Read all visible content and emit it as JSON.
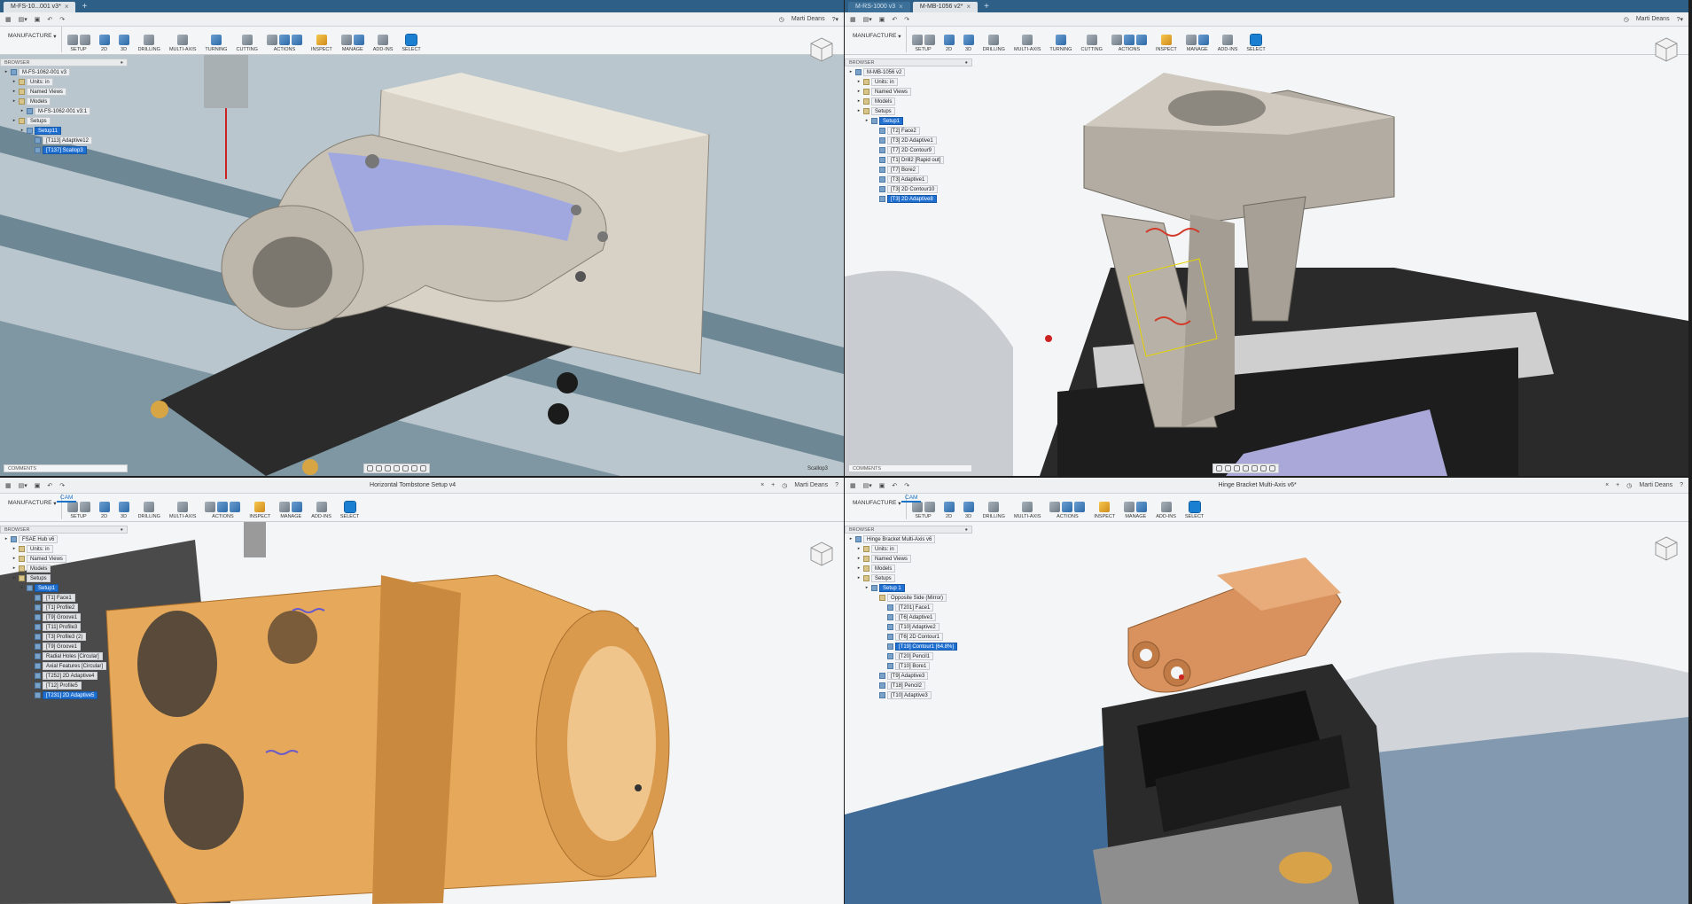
{
  "panes": [
    {
      "tabs": [
        {
          "label": "M-FS-10...001 v3*",
          "active": true
        }
      ],
      "user": "Marti Deans",
      "workspace": "MANUFACTURE",
      "groups": [
        "SETUP",
        "2D",
        "3D",
        "DRILLING",
        "MULTI-AXIS",
        "TURNING",
        "CUTTING",
        "ACTIONS",
        "INSPECT",
        "MANAGE",
        "ADD-INS",
        "SELECT"
      ],
      "browser_title": "BROWSER",
      "tree": [
        {
          "label": "M-FS-1062-001 v3",
          "depth": 0,
          "icon": "document-icon"
        },
        {
          "label": "Units: in",
          "depth": 1,
          "icon": "folder-icon"
        },
        {
          "label": "Named Views",
          "depth": 1,
          "icon": "folder-icon"
        },
        {
          "label": "Models",
          "depth": 1,
          "icon": "folder-icon"
        },
        {
          "label": "M-FS-1062-001 v3:1",
          "depth": 2,
          "icon": "component-icon"
        },
        {
          "label": "Setups",
          "depth": 1,
          "icon": "folder-icon"
        },
        {
          "label": "Setup11",
          "depth": 2,
          "icon": "setup-icon",
          "selected": true
        },
        {
          "label": "[T113] Adaptive12",
          "depth": 3,
          "icon": "toolpath-icon"
        },
        {
          "label": "[T137] Scallop3",
          "depth": 3,
          "icon": "toolpath-icon",
          "selected": true
        }
      ],
      "comments": "COMMENTS",
      "operation": "Scallop3"
    },
    {
      "tabs": [
        {
          "label": "M-RS-1000 v3",
          "active": false
        },
        {
          "label": "M-MB-1056 v2*",
          "active": true
        }
      ],
      "user": "Marti Deans",
      "workspace": "MANUFACTURE",
      "groups": [
        "SETUP",
        "2D",
        "3D",
        "DRILLING",
        "MULTI-AXIS",
        "TURNING",
        "CUTTING",
        "ACTIONS",
        "INSPECT",
        "MANAGE",
        "ADD-INS",
        "SELECT"
      ],
      "browser_title": "BROWSER",
      "tree": [
        {
          "label": "M-MB-1056 v2",
          "depth": 0,
          "icon": "document-icon"
        },
        {
          "label": "Units: in",
          "depth": 1,
          "icon": "folder-icon"
        },
        {
          "label": "Named Views",
          "depth": 1,
          "icon": "folder-icon"
        },
        {
          "label": "Models",
          "depth": 1,
          "icon": "folder-icon"
        },
        {
          "label": "Setups",
          "depth": 1,
          "icon": "folder-icon"
        },
        {
          "label": "Setup1",
          "depth": 2,
          "icon": "setup-icon",
          "selected": true
        },
        {
          "label": "[T2] Face2",
          "depth": 3,
          "icon": "toolpath-icon"
        },
        {
          "label": "[T3] 2D Adaptive1",
          "depth": 3,
          "icon": "toolpath-icon"
        },
        {
          "label": "[T7] 2D Contour9",
          "depth": 3,
          "icon": "toolpath-icon"
        },
        {
          "label": "[T1] Drill2 [Rapid out]",
          "depth": 3,
          "icon": "toolpath-icon"
        },
        {
          "label": "[T7] Bore2",
          "depth": 3,
          "icon": "toolpath-icon"
        },
        {
          "label": "[T3] Adaptive1",
          "depth": 3,
          "icon": "toolpath-icon"
        },
        {
          "label": "[T3] 2D Contour10",
          "depth": 3,
          "icon": "toolpath-icon"
        },
        {
          "label": "[T3] 2D Adaptive8",
          "depth": 3,
          "icon": "toolpath-icon",
          "selected": true
        }
      ],
      "comments": "COMMENTS",
      "operation": ""
    },
    {
      "doc_title": "Horizontal Tombstone Setup v4",
      "user": "Marti Deans",
      "workspace": "MANUFACTURE",
      "tab": "CAM",
      "groups": [
        "SETUP",
        "2D",
        "3D",
        "DRILLING",
        "MULTI-AXIS",
        "ACTIONS",
        "INSPECT",
        "MANAGE",
        "ADD-INS",
        "SELECT"
      ],
      "browser_title": "BROWSER",
      "tree": [
        {
          "label": "FSAE Hub v6",
          "depth": 0,
          "icon": "document-icon"
        },
        {
          "label": "Units: in",
          "depth": 1,
          "icon": "folder-icon"
        },
        {
          "label": "Named Views",
          "depth": 1,
          "icon": "folder-icon"
        },
        {
          "label": "Models",
          "depth": 1,
          "icon": "folder-icon"
        },
        {
          "label": "Setups",
          "depth": 1,
          "icon": "folder-icon"
        },
        {
          "label": "Setup1",
          "depth": 2,
          "icon": "setup-icon",
          "selected": true
        },
        {
          "label": "[T1] Face1",
          "depth": 3,
          "icon": "toolpath-icon"
        },
        {
          "label": "[T1] Profile2",
          "depth": 3,
          "icon": "toolpath-icon"
        },
        {
          "label": "[T9] Groove1",
          "depth": 3,
          "icon": "toolpath-icon"
        },
        {
          "label": "[T11] Profile3",
          "depth": 3,
          "icon": "toolpath-icon"
        },
        {
          "label": "[T3] Profile3 (2)",
          "depth": 3,
          "icon": "toolpath-icon"
        },
        {
          "label": "[T9] Groove1",
          "depth": 3,
          "icon": "toolpath-icon"
        },
        {
          "label": "Radial Holes [Circular]",
          "depth": 3,
          "icon": "pattern-icon"
        },
        {
          "label": "Axial Features [Circular]",
          "depth": 3,
          "icon": "pattern-icon"
        },
        {
          "label": "[T252] 2D Adaptive4",
          "depth": 3,
          "icon": "toolpath-icon"
        },
        {
          "label": "[T12] Profile5",
          "depth": 3,
          "icon": "toolpath-icon"
        },
        {
          "label": "[T231] 2D Adaptive5",
          "depth": 3,
          "icon": "toolpath-icon",
          "selected": true
        }
      ],
      "operation": ""
    },
    {
      "doc_title": "Hinge Bracket Multi-Axis v6*",
      "user": "Marti Deans",
      "workspace": "MANUFACTURE",
      "tab": "CAM",
      "groups": [
        "SETUP",
        "2D",
        "3D",
        "DRILLING",
        "MULTI-AXIS",
        "ACTIONS",
        "INSPECT",
        "MANAGE",
        "ADD-INS",
        "SELECT"
      ],
      "browser_title": "BROWSER",
      "tree": [
        {
          "label": "Hinge Bracket Multi-Axis v6",
          "depth": 0,
          "icon": "document-icon"
        },
        {
          "label": "Units: in",
          "depth": 1,
          "icon": "folder-icon"
        },
        {
          "label": "Named Views",
          "depth": 1,
          "icon": "folder-icon"
        },
        {
          "label": "Models",
          "depth": 1,
          "icon": "folder-icon"
        },
        {
          "label": "Setups",
          "depth": 1,
          "icon": "folder-icon"
        },
        {
          "label": "Setup 1",
          "depth": 2,
          "icon": "setup-icon",
          "selected": true
        },
        {
          "label": "Opposite Side (Mirror)",
          "depth": 3,
          "icon": "folder-icon"
        },
        {
          "label": "[T201] Face1",
          "depth": 4,
          "icon": "toolpath-icon"
        },
        {
          "label": "[T6] Adaptive1",
          "depth": 4,
          "icon": "toolpath-icon"
        },
        {
          "label": "[T10] Adaptive2",
          "depth": 4,
          "icon": "toolpath-icon"
        },
        {
          "label": "[T6] 2D Contour1",
          "depth": 4,
          "icon": "toolpath-icon"
        },
        {
          "label": "[T19] Contour1 [64.8%]",
          "depth": 4,
          "icon": "toolpath-icon",
          "selected": true
        },
        {
          "label": "[T20] Pencil1",
          "depth": 4,
          "icon": "toolpath-icon"
        },
        {
          "label": "[T10] Bore1",
          "depth": 4,
          "icon": "toolpath-icon"
        },
        {
          "label": "[T9] Adaptive3",
          "depth": 3,
          "icon": "toolpath-icon"
        },
        {
          "label": "[T18] Pencil2",
          "depth": 3,
          "icon": "toolpath-icon"
        },
        {
          "label": "[T10] Adaptive3",
          "depth": 3,
          "icon": "toolpath-icon"
        }
      ],
      "operation": ""
    }
  ],
  "colors": {
    "tabbar": "#2e5f86",
    "selection": "#1f6fd1",
    "aluminum": "#c9c4ba",
    "brass": "#e6a85a",
    "copper": "#d9925e",
    "table": "#8fa4ad"
  }
}
